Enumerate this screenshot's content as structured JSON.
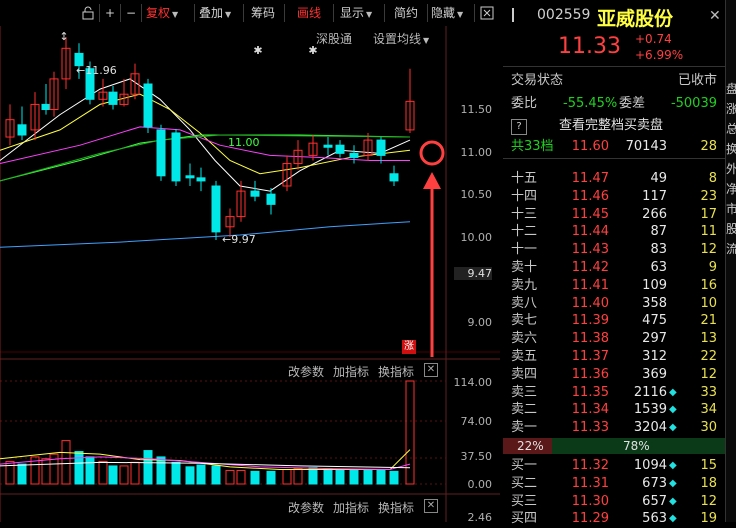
{
  "toolbar": {
    "buttons": [
      "+",
      "−",
      "复权",
      "叠加",
      "筹码",
      "画线",
      "显示",
      "简约",
      "隐藏"
    ]
  },
  "chart": {
    "top_links": [
      "深股通",
      "设置均线"
    ],
    "price_axis": [
      "11.50",
      "11.00",
      "10.50",
      "10.00",
      "9.47",
      "9.00"
    ],
    "high_label": "11.96",
    "low_label": "9.97",
    "ma_label": "11.00",
    "limit_up_badge": "涨",
    "indicator_links": [
      "改参数",
      "加指标",
      "换指标"
    ],
    "volume_axis": [
      "114.00",
      "74.00",
      "37.50",
      "0.00"
    ],
    "bottom_axis": "2.46",
    "colors": {
      "up": "#ff3030",
      "down": "#00e8e8",
      "ma5": "#ffffff",
      "ma10": "#ffff40",
      "ma20": "#ff40ff",
      "ma30": "#40ff40",
      "ma60": "#40a0ff",
      "annotation": "#ff4040"
    }
  },
  "stock": {
    "code": "002559",
    "name": "亚威股份",
    "price": "11.33",
    "change": "+0.74",
    "change_pct": "+6.99%"
  },
  "panel": {
    "status_label": "交易状态",
    "status_value": "已收市",
    "weibi_label": "委比",
    "weibi_value": "-55.45%",
    "weicha_label": "委差",
    "weicha_value": "-50039",
    "full_book_link": "查看完整档买卖盘",
    "total_levels": "共33档",
    "total_price": "11.60",
    "total_volume": "70143",
    "total_count": "28",
    "asks": [
      {
        "label": "十五",
        "price": "11.47",
        "volume": "49",
        "count": "8",
        "dia": false
      },
      {
        "label": "十四",
        "price": "11.46",
        "volume": "117",
        "count": "23",
        "dia": false
      },
      {
        "label": "十三",
        "price": "11.45",
        "volume": "266",
        "count": "17",
        "dia": false
      },
      {
        "label": "十二",
        "price": "11.44",
        "volume": "87",
        "count": "11",
        "dia": false
      },
      {
        "label": "十一",
        "price": "11.43",
        "volume": "83",
        "count": "12",
        "dia": false
      },
      {
        "label": "卖十",
        "price": "11.42",
        "volume": "63",
        "count": "9",
        "dia": false
      },
      {
        "label": "卖九",
        "price": "11.41",
        "volume": "109",
        "count": "16",
        "dia": false
      },
      {
        "label": "卖八",
        "price": "11.40",
        "volume": "358",
        "count": "10",
        "dia": false
      },
      {
        "label": "卖七",
        "price": "11.39",
        "volume": "475",
        "count": "21",
        "dia": false
      },
      {
        "label": "卖六",
        "price": "11.38",
        "volume": "297",
        "count": "13",
        "dia": false
      },
      {
        "label": "卖五",
        "price": "11.37",
        "volume": "312",
        "count": "22",
        "dia": false
      },
      {
        "label": "卖四",
        "price": "11.36",
        "volume": "369",
        "count": "12",
        "dia": false
      },
      {
        "label": "卖三",
        "price": "11.35",
        "volume": "2116",
        "count": "33",
        "dia": true
      },
      {
        "label": "卖二",
        "price": "11.34",
        "volume": "1539",
        "count": "34",
        "dia": true
      },
      {
        "label": "卖一",
        "price": "11.33",
        "volume": "3204",
        "count": "30",
        "dia": true
      }
    ],
    "ratio_sell": "22%",
    "ratio_buy": "78%",
    "ratio_buy_fraction": 0.78,
    "bids": [
      {
        "label": "买一",
        "price": "11.32",
        "volume": "1094",
        "count": "15",
        "dia": true
      },
      {
        "label": "买二",
        "price": "11.31",
        "volume": "673",
        "count": "18",
        "dia": true
      },
      {
        "label": "买三",
        "price": "11.30",
        "volume": "657",
        "count": "12",
        "dia": true
      },
      {
        "label": "买四",
        "price": "11.29",
        "volume": "563",
        "count": "19",
        "dia": true
      }
    ]
  },
  "edge_chars": [
    "盘",
    "涨",
    "总",
    "换",
    "外",
    "净",
    "市",
    "股",
    "流"
  ]
}
